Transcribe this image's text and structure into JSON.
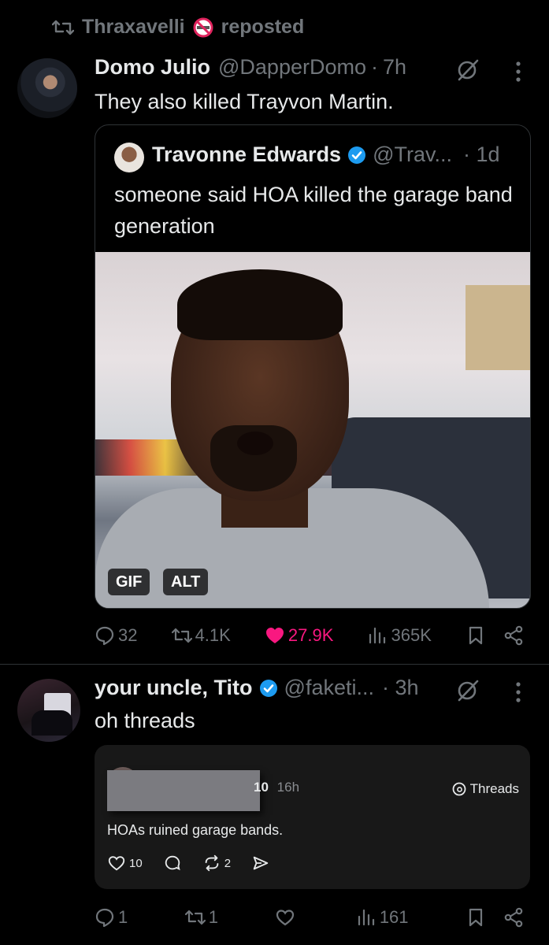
{
  "repost": {
    "label": "Thraxavelli",
    "suffix": "reposted"
  },
  "tweet1": {
    "display_name": "Domo Julio",
    "handle": "@DapperDomo",
    "sep": "·",
    "time": "7h",
    "text": "They also killed Trayvon Martin.",
    "quote": {
      "display_name": "Travonne Edwards",
      "handle": "@Trav...",
      "time": "· 1d",
      "text": "someone said HOA killed the garage band generation",
      "badges": {
        "gif": "GIF",
        "alt": "ALT"
      }
    },
    "actions": {
      "replies": "32",
      "reposts": "4.1K",
      "likes": "27.9K",
      "views": "365K"
    }
  },
  "tweet2": {
    "display_name": "your uncle, Tito",
    "handle": "@faketi...",
    "time": "· 3h",
    "text": "oh threads",
    "embed": {
      "author_tail": "10",
      "time": "16h",
      "source": "Threads",
      "text": "HOAs ruined garage bands.",
      "likes": "10",
      "reposts": "2"
    },
    "actions": {
      "replies": "1",
      "reposts": "1",
      "likes": "",
      "views": "161"
    }
  },
  "colors": {
    "background": "#000000",
    "text": "#e7e9ea",
    "muted": "#71767b",
    "like": "#f91880",
    "verified": "#1d9bf0",
    "divider": "#2f3336"
  }
}
